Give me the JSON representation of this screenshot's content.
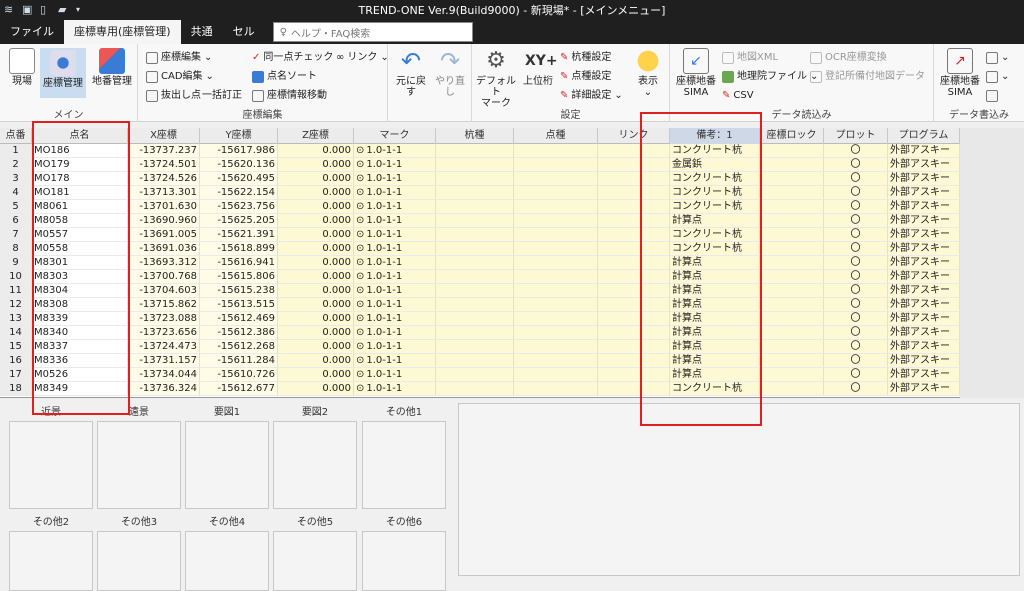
{
  "window": {
    "title": "TREND-ONE Ver.9(Build9000) - 新現場* - [メインメニュー]"
  },
  "tabs": [
    {
      "label": "ファイル",
      "active": false
    },
    {
      "label": "座標専用(座標管理)",
      "active": true
    },
    {
      "label": "共通",
      "active": false
    },
    {
      "label": "セル",
      "active": false
    }
  ],
  "search": {
    "placeholder": "ヘルプ・FAQ検索"
  },
  "ribbon": {
    "main": {
      "label": "メイン",
      "buttons": [
        "現場",
        "座標管理",
        "地番管理"
      ]
    },
    "coord_edit": {
      "label": "座標編集",
      "items": [
        "座標編集",
        "CAD編集",
        "抜出し点",
        "一括訂正",
        "同一点チェック",
        "点名ソート",
        "座標情報移動",
        "リンク"
      ]
    },
    "undo": {
      "undo": "元に戻す",
      "redo": "やり直し"
    },
    "settings": {
      "label": "設定",
      "default_mark_1": "デフォルト",
      "default_mark_2": "マーク",
      "top_digit": "上位桁",
      "kui": "杭種設定",
      "ten": "点種設定",
      "detail": "詳細設定",
      "display": "表示"
    },
    "data_read": {
      "label": "データ読込み",
      "sima_1": "座標地番",
      "sima_2": "SIMA",
      "chiriin": "地理院ファイル",
      "csv": "CSV",
      "chizu": "地図XML",
      "ocr": "OCR座標変換",
      "toki": "登記所備付地図データ"
    },
    "data_write": {
      "label": "データ書込み",
      "sima_1": "座標地番",
      "sima_2": "SIMA"
    }
  },
  "grid": {
    "headers": [
      "点番",
      "点名",
      "X座標",
      "Y座標",
      "Z座標",
      "マーク",
      "杭種",
      "点種",
      "リンク",
      "備考：1",
      "座標ロック",
      "プロット",
      "プログラム"
    ],
    "rows": [
      {
        "no": "1",
        "name": "MO186",
        "x": "-13737.237",
        "y": "-15617.986",
        "z": "0.000",
        "mark": "1.0-1-1",
        "note": "コンクリート杭",
        "plot": "〇",
        "program": "外部アスキー"
      },
      {
        "no": "2",
        "name": "MO179",
        "x": "-13724.501",
        "y": "-15620.136",
        "z": "0.000",
        "mark": "1.0-1-1",
        "note": "金属鋲",
        "plot": "〇",
        "program": "外部アスキー"
      },
      {
        "no": "3",
        "name": "MO178",
        "x": "-13724.526",
        "y": "-15620.495",
        "z": "0.000",
        "mark": "1.0-1-1",
        "note": "コンクリート杭",
        "plot": "〇",
        "program": "外部アスキー"
      },
      {
        "no": "4",
        "name": "MO181",
        "x": "-13713.301",
        "y": "-15622.154",
        "z": "0.000",
        "mark": "1.0-1-1",
        "note": "コンクリート杭",
        "plot": "〇",
        "program": "外部アスキー"
      },
      {
        "no": "5",
        "name": "M8061",
        "x": "-13701.630",
        "y": "-15623.756",
        "z": "0.000",
        "mark": "1.0-1-1",
        "note": "コンクリート杭",
        "plot": "〇",
        "program": "外部アスキー"
      },
      {
        "no": "6",
        "name": "M8058",
        "x": "-13690.960",
        "y": "-15625.205",
        "z": "0.000",
        "mark": "1.0-1-1",
        "note": "計算点",
        "plot": "〇",
        "program": "外部アスキー"
      },
      {
        "no": "7",
        "name": "M0557",
        "x": "-13691.005",
        "y": "-15621.391",
        "z": "0.000",
        "mark": "1.0-1-1",
        "note": "コンクリート杭",
        "plot": "〇",
        "program": "外部アスキー"
      },
      {
        "no": "8",
        "name": "M0558",
        "x": "-13691.036",
        "y": "-15618.899",
        "z": "0.000",
        "mark": "1.0-1-1",
        "note": "コンクリート杭",
        "plot": "〇",
        "program": "外部アスキー"
      },
      {
        "no": "9",
        "name": "M8301",
        "x": "-13693.312",
        "y": "-15616.941",
        "z": "0.000",
        "mark": "1.0-1-1",
        "note": "計算点",
        "plot": "〇",
        "program": "外部アスキー"
      },
      {
        "no": "10",
        "name": "M8303",
        "x": "-13700.768",
        "y": "-15615.806",
        "z": "0.000",
        "mark": "1.0-1-1",
        "note": "計算点",
        "plot": "〇",
        "program": "外部アスキー"
      },
      {
        "no": "11",
        "name": "M8304",
        "x": "-13704.603",
        "y": "-15615.238",
        "z": "0.000",
        "mark": "1.0-1-1",
        "note": "計算点",
        "plot": "〇",
        "program": "外部アスキー"
      },
      {
        "no": "12",
        "name": "M8308",
        "x": "-13715.862",
        "y": "-15613.515",
        "z": "0.000",
        "mark": "1.0-1-1",
        "note": "計算点",
        "plot": "〇",
        "program": "外部アスキー"
      },
      {
        "no": "13",
        "name": "M8339",
        "x": "-13723.088",
        "y": "-15612.469",
        "z": "0.000",
        "mark": "1.0-1-1",
        "note": "計算点",
        "plot": "〇",
        "program": "外部アスキー"
      },
      {
        "no": "14",
        "name": "M8340",
        "x": "-13723.656",
        "y": "-15612.386",
        "z": "0.000",
        "mark": "1.0-1-1",
        "note": "計算点",
        "plot": "〇",
        "program": "外部アスキー"
      },
      {
        "no": "15",
        "name": "M8337",
        "x": "-13724.473",
        "y": "-15612.268",
        "z": "0.000",
        "mark": "1.0-1-1",
        "note": "計算点",
        "plot": "〇",
        "program": "外部アスキー"
      },
      {
        "no": "16",
        "name": "M8336",
        "x": "-13731.157",
        "y": "-15611.284",
        "z": "0.000",
        "mark": "1.0-1-1",
        "note": "計算点",
        "plot": "〇",
        "program": "外部アスキー"
      },
      {
        "no": "17",
        "name": "M0526",
        "x": "-13734.044",
        "y": "-15610.726",
        "z": "0.000",
        "mark": "1.0-1-1",
        "note": "計算点",
        "plot": "〇",
        "program": "外部アスキー"
      },
      {
        "no": "18",
        "name": "M8349",
        "x": "-13736.324",
        "y": "-15612.677",
        "z": "0.000",
        "mark": "1.0-1-1",
        "note": "コンクリート杭",
        "plot": "〇",
        "program": "外部アスキー"
      }
    ]
  },
  "thumbs": {
    "row1": [
      "近景",
      "遠景",
      "要図1",
      "要図2",
      "その他1"
    ],
    "row2": [
      "その他2",
      "その他3",
      "その他4",
      "その他5",
      "その他6"
    ]
  },
  "colors": {
    "highlight": "#e02020",
    "coord_bg": "#fefce6",
    "z_bg": "#fdf9d4"
  }
}
